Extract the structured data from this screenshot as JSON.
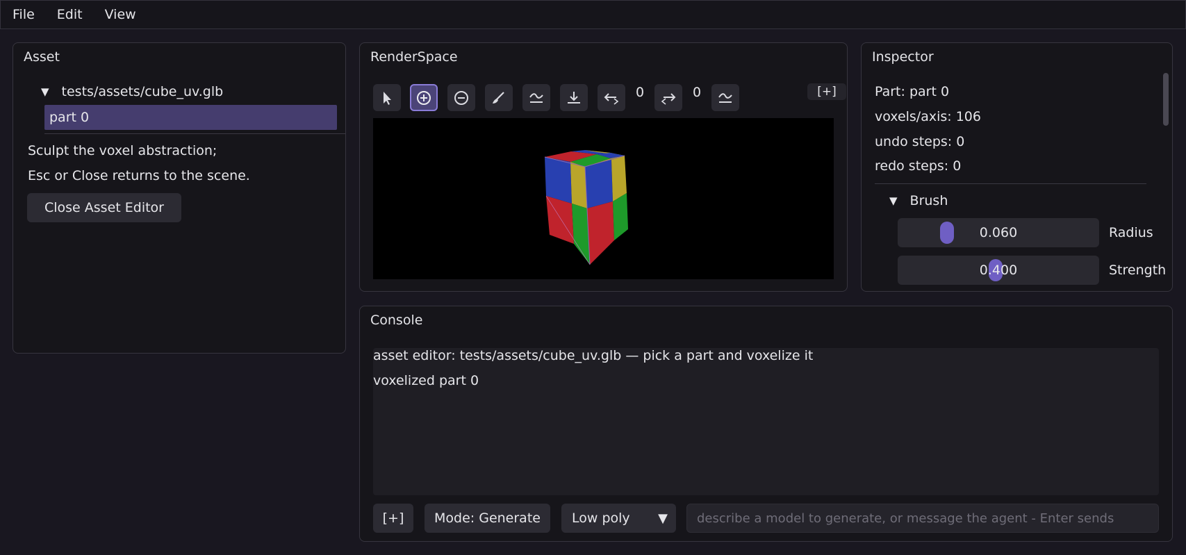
{
  "menu": {
    "file": "File",
    "edit": "Edit",
    "view": "View"
  },
  "asset": {
    "title": "Asset",
    "file": "tests/assets/cube_uv.glb",
    "part": "part 0",
    "help1": "Sculpt the voxel abstraction;",
    "help2": "Esc or Close returns to the scene.",
    "close_label": "Close Asset Editor"
  },
  "render": {
    "title": "RenderSpace",
    "tools": [
      "select-icon",
      "add-voxel-icon",
      "remove-voxel-icon",
      "brush-icon",
      "smooth-icon",
      "flatten-icon",
      "undo-icon",
      "redo-icon",
      "smooth-alt-icon"
    ],
    "undo_count": "0",
    "redo_count": "0",
    "fullscreen_label": "[+]"
  },
  "inspector": {
    "part": "Part: part 0",
    "voxels": "voxels/axis: 106",
    "undo": "undo steps: 0",
    "redo": "redo steps: 0",
    "brush_title": "Brush",
    "radius": {
      "value": "0.060",
      "label": "Radius",
      "fraction": 0.06
    },
    "strength": {
      "value": "0.400",
      "label": "Strength",
      "fraction": 0.4
    }
  },
  "console": {
    "title": "Console",
    "lines": [
      "asset editor: tests/assets/cube_uv.glb — pick a part and voxelize it",
      "voxelized part 0"
    ],
    "plus_label": "[+]",
    "mode_label": "Mode: Generate",
    "quality": "Low poly",
    "placeholder": "describe a model to generate, or message the agent - Enter sends"
  },
  "colors": {
    "accent": "#6f5fc4",
    "selection": "#453d6e",
    "cube_red": "#c0232c",
    "cube_blue": "#2840b0",
    "cube_green": "#1e9a2a",
    "cube_yellow": "#b9a52a"
  }
}
